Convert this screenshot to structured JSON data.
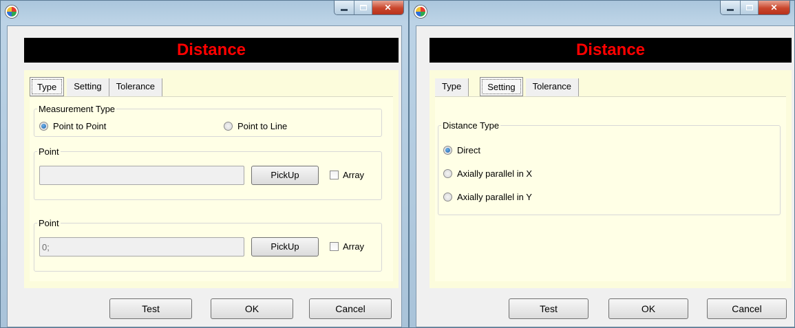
{
  "windows": [
    {
      "title_banner": "Distance",
      "tabs": [
        {
          "label": "Type",
          "active": true
        },
        {
          "label": "Setting",
          "active": false
        },
        {
          "label": "Tolerance",
          "active": false
        }
      ],
      "measurement_type": {
        "legend": "Measurement Type",
        "options": [
          {
            "label": "Point to Point",
            "checked": true
          },
          {
            "label": "Point to Line",
            "checked": false
          }
        ]
      },
      "point_groups": [
        {
          "legend": "Point",
          "value": "",
          "pickup_label": "PickUp",
          "array_label": "Array",
          "array_checked": false
        },
        {
          "legend": "Point",
          "value": "0;",
          "pickup_label": "PickUp",
          "array_label": "Array",
          "array_checked": false
        }
      ],
      "buttons": {
        "test": "Test",
        "ok": "OK",
        "cancel": "Cancel"
      }
    },
    {
      "title_banner": "Distance",
      "tabs": [
        {
          "label": "Type",
          "active": false
        },
        {
          "label": "Setting",
          "active": true
        },
        {
          "label": "Tolerance",
          "active": false
        }
      ],
      "distance_type": {
        "legend": "Distance Type",
        "options": [
          {
            "label": "Direct",
            "checked": true
          },
          {
            "label": "Axially parallel in X",
            "checked": false
          },
          {
            "label": "Axially parallel in Y",
            "checked": false
          }
        ]
      },
      "buttons": {
        "test": "Test",
        "ok": "OK",
        "cancel": "Cancel"
      }
    }
  ],
  "icons": {
    "app": "app-logo-icon",
    "minimize": "minimize-icon",
    "maximize": "maximize-icon",
    "close": "close-icon"
  },
  "colors": {
    "banner_bg": "#000000",
    "banner_text": "#ff0000",
    "panel_bg": "#ffffe6",
    "frame_bg": "#fcfcdc"
  }
}
